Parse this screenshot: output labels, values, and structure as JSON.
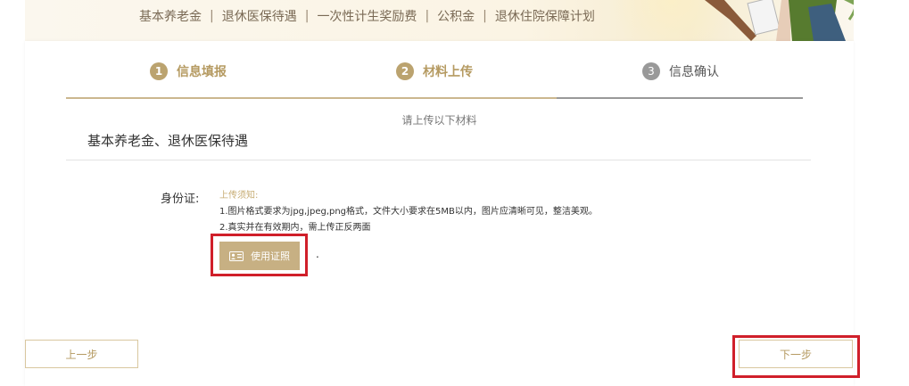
{
  "top_nav": {
    "links": [
      "基本养老金",
      "退休医保待遇",
      "一次性计生奖励费",
      "公积金",
      "退休住院保障计划"
    ],
    "separator": "|"
  },
  "steps": [
    {
      "number": "1",
      "label": "信息填报",
      "state": "completed"
    },
    {
      "number": "2",
      "label": "材料上传",
      "state": "active"
    },
    {
      "number": "3",
      "label": "信息确认",
      "state": "pending"
    }
  ],
  "upload_hint": "请上传以下材料",
  "section_title": "基本养老金、退休医保待遇",
  "id_card": {
    "label": "身份证:",
    "notice_title": "上传须知:",
    "notice_line1": "1.图片格式要求为jpg,jpeg,png格式，文件大小要求在5MB以内，图片应清晰可见，整洁美观。",
    "notice_line2": "2.真实并在有效期内，需上传正反两面",
    "use_cert_button": "使用证照",
    "trailing_mark": "."
  },
  "buttons": {
    "prev": "上一步",
    "next": "下一步"
  },
  "colors": {
    "accent": "#bba36f",
    "highlight_box": "#d01f2a",
    "pending": "#999999"
  },
  "icons": [
    "id-card-icon",
    "illustration-figures"
  ]
}
